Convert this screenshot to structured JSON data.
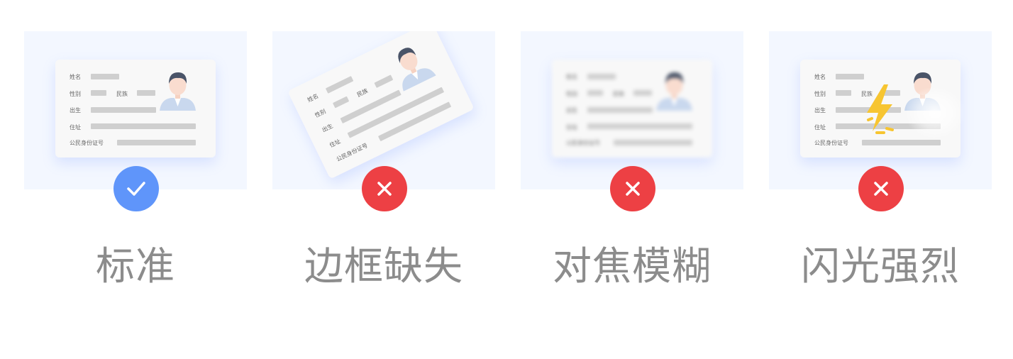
{
  "card_fields": {
    "name": "姓名",
    "gender": "性别",
    "ethnicity": "民族",
    "birth": "出生",
    "address": "住址",
    "id_number": "公民身份证号"
  },
  "options": [
    {
      "caption": "标准",
      "status": "correct",
      "status_icon": "check-icon",
      "color": "#5f95fa"
    },
    {
      "caption": "边框缺失",
      "status": "incorrect",
      "status_icon": "close-icon",
      "color": "#ed4044"
    },
    {
      "caption": "对焦模糊",
      "status": "incorrect",
      "status_icon": "close-icon",
      "color": "#ed4044"
    },
    {
      "caption": "闪光强烈",
      "status": "incorrect",
      "status_icon": "close-icon",
      "color": "#ed4044"
    }
  ],
  "colors": {
    "panel_bg": "#f3f7ff",
    "caption_text": "#8c8c8c",
    "flash": "#f7c531"
  }
}
